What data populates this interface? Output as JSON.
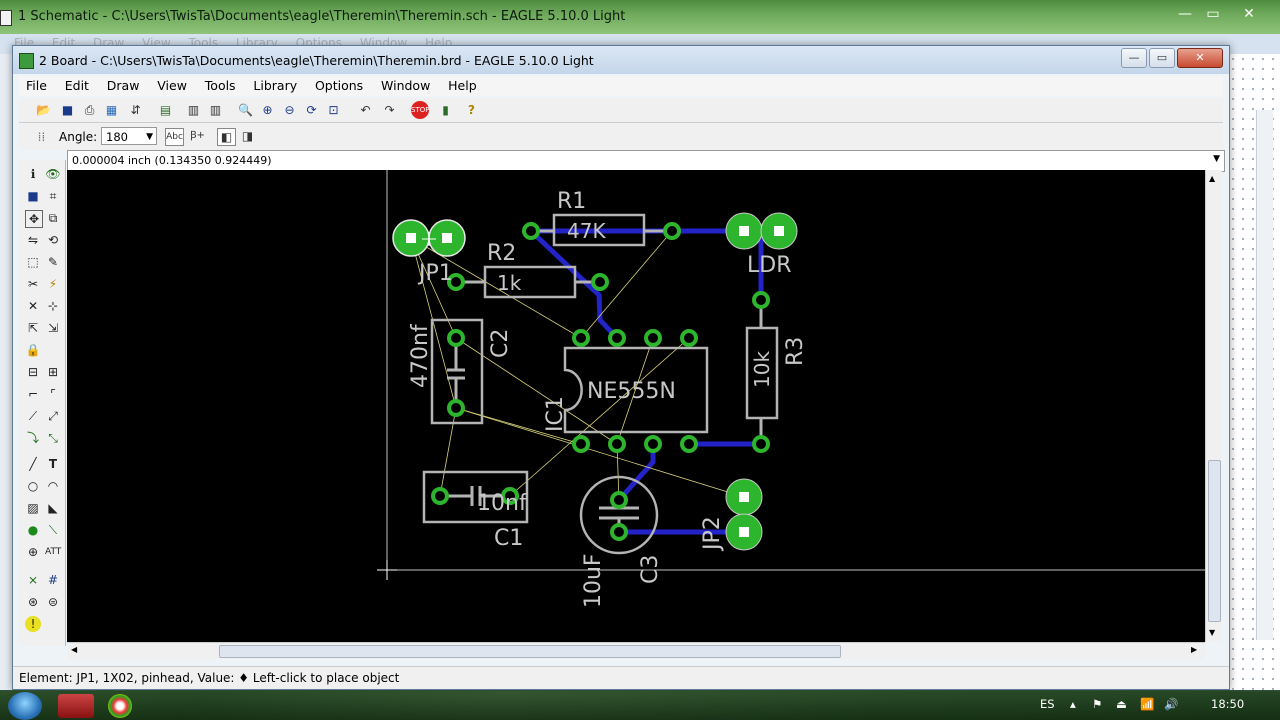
{
  "background_window": {
    "title": "1 Schematic - C:\\Users\\TwisTa\\Documents\\eagle\\Theremin\\Theremin.sch - EAGLE 5.10.0 Light",
    "menu": [
      "File",
      "Edit",
      "Draw",
      "View",
      "Tools",
      "Library",
      "Options",
      "Window",
      "Help"
    ]
  },
  "window": {
    "title": "2 Board - C:\\Users\\TwisTa\\Documents\\eagle\\Theremin\\Theremin.brd - EAGLE 5.10.0 Light",
    "minimize": "—",
    "maximize": "▭",
    "close": "✕"
  },
  "menu": [
    "File",
    "Edit",
    "Draw",
    "View",
    "Tools",
    "Library",
    "Options",
    "Window",
    "Help"
  ],
  "toolbar": {
    "angle_label": "Angle:",
    "angle_value": "180"
  },
  "command_line": {
    "coordinates": "0.000004 inch (0.134350 0.924449)",
    "input_value": ""
  },
  "status_bar": {
    "text": "Element: JP1, 1X02, pinhead, Value:  ♦ Left-click to place object"
  },
  "board": {
    "labels": {
      "r1": "R1",
      "r1_value": "47K",
      "r2": "R2",
      "r2_value": "1k",
      "jp1": "JP1",
      "ldr": "LDR",
      "r3": "R3",
      "r3_value": "10k",
      "c2": "C2",
      "c2_value": "470nf",
      "ic1": "IC1",
      "ic1_value": "NE555N",
      "c1": "C1",
      "c1_value": "10nf",
      "c3": "C3",
      "c3_value": "10uF",
      "jp2": "JP2"
    },
    "colors": {
      "background": "#000000",
      "pad": "#2db52d",
      "outline": "#b4b4b4",
      "trace": "#2323c8",
      "airwire": "#d8d27a"
    }
  },
  "taskbar": {
    "language": "ES",
    "clock": "18:50"
  }
}
